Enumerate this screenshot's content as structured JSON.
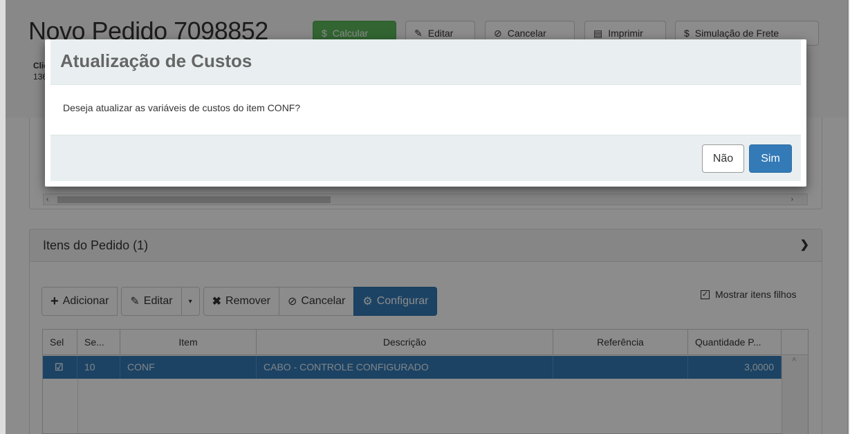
{
  "header": {
    "title": "Novo Pedido 7098852",
    "client_label": "Clie",
    "client_code": "136",
    "buttons": {
      "calcular": "Calcular",
      "editar": "Editar",
      "cancelar": "Cancelar",
      "imprimir": "Imprimir",
      "simulacao": "Simulação de Frete"
    }
  },
  "items_panel": {
    "title": "Itens do Pedido (1)",
    "toolbar": {
      "adicionar": "Adicionar",
      "editar": "Editar",
      "remover": "Remover",
      "cancelar": "Cancelar",
      "configurar": "Configurar"
    },
    "show_children_label": "Mostrar itens filhos",
    "show_children_checked": true,
    "columns": [
      "Sel",
      "Se...",
      "Item",
      "Descrição",
      "Referência",
      "Quantidade P..."
    ],
    "rows": [
      {
        "seq": "10",
        "item": "CONF",
        "descricao": "CABO - CONTROLE CONFIGURADO",
        "referencia": "",
        "quantidade": "3,0000",
        "selected": true
      }
    ]
  },
  "modal": {
    "title": "Atualização de Custos",
    "message": "Deseja atualizar as variáveis de custos do item CONF?",
    "no_label": "Não",
    "yes_label": "Sim"
  },
  "colors": {
    "primary": "#337ab7",
    "success": "#5cb85c",
    "modal_header_bg": "#e9eff0"
  }
}
